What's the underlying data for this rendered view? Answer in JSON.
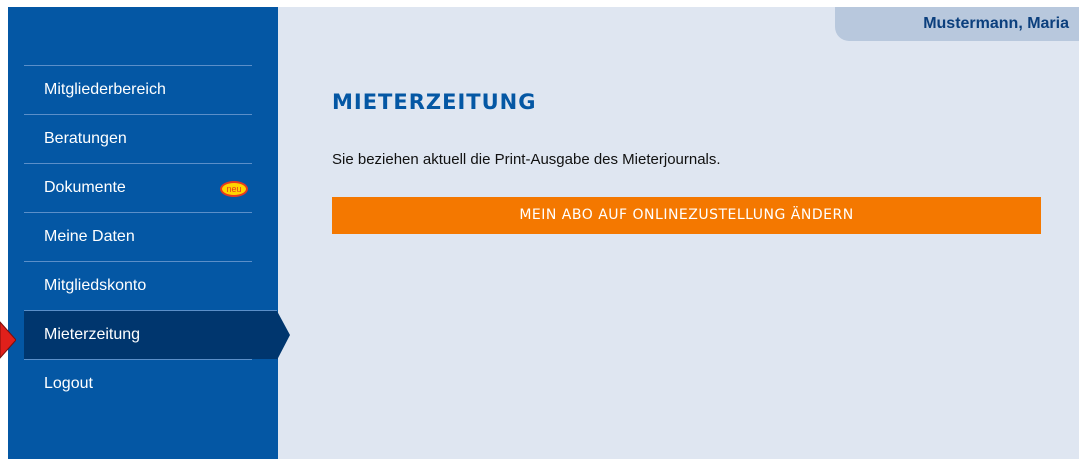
{
  "user": {
    "name": "Mustermann, Maria"
  },
  "sidebar": {
    "items": [
      {
        "label": "Mitgliederbereich"
      },
      {
        "label": "Beratungen"
      },
      {
        "label": "Dokumente",
        "badge": "neu"
      },
      {
        "label": "Meine Daten"
      },
      {
        "label": "Mitgliedskonto"
      },
      {
        "label": "Mieterzeitung",
        "active": true
      },
      {
        "label": "Logout"
      }
    ]
  },
  "main": {
    "title": "MIETERZEITUNG",
    "text": "Sie beziehen aktuell die Print-Ausgabe des Mieterjournals.",
    "button_label": "MEIN ABO AUF ONLINEZUSTELLUNG ÄNDERN"
  },
  "colors": {
    "sidebar": "#0457a4",
    "sidebar_active": "#00366e",
    "background": "#dfe6f1",
    "accent": "#f47800",
    "user_tab": "#b8c8dd",
    "pointer": "#e0201b"
  },
  "icons": {
    "badge": "new-badge-icon",
    "pointer": "red-arrow-pointer-icon"
  }
}
